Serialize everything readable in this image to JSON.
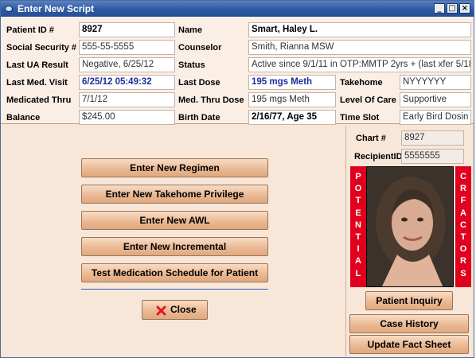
{
  "window": {
    "title": "Enter New Script"
  },
  "window_buttons": {
    "minimize": "_",
    "maximize": "□",
    "close": "×"
  },
  "fields": {
    "patient_id": {
      "label": "Patient ID #",
      "value": "8927"
    },
    "name": {
      "label": "Name",
      "value": "Smart, Haley L."
    },
    "ssn": {
      "label": "Social Security #",
      "value": "555-55-5555"
    },
    "counselor": {
      "label": "Counselor",
      "value": "Smith, Rianna  MSW"
    },
    "last_ua": {
      "label": "Last UA Result",
      "value": "Negative, 6/25/12"
    },
    "status": {
      "label": "Status",
      "value": "Active since 9/1/11 in OTP:MMTP 2yrs + (last xfer 5/18"
    },
    "last_med_visit": {
      "label": "Last Med. Visit",
      "value": "6/25/12 05:49:32"
    },
    "last_dose": {
      "label": "Last Dose",
      "value": "195 mgs Meth"
    },
    "takehome": {
      "label": "Takehome",
      "value": "NYYYYYY"
    },
    "medicated_thru": {
      "label": "Medicated Thru",
      "value": "7/1/12"
    },
    "med_thru_dose": {
      "label": "Med. Thru Dose",
      "value": "195 mgs Meth"
    },
    "level_of_care": {
      "label": "Level Of Care",
      "value": "Supportive"
    },
    "balance": {
      "label": "Balance",
      "value": "$245.00"
    },
    "birth_date": {
      "label": "Birth Date",
      "value": "2/16/77, Age 35"
    },
    "time_slot": {
      "label": "Time Slot",
      "value": "Early Bird Dosin"
    }
  },
  "actions": {
    "new_regimen": "Enter New Regimen",
    "new_takehome": "Enter New Takehome Privilege",
    "new_awl": "Enter New AWL",
    "new_incremental": "Enter New Incremental",
    "test_schedule": "Test Medication Schedule for Patient",
    "close": "Close"
  },
  "side": {
    "chart_label": "Chart #",
    "chart_value": "8927",
    "recipient_label": "RecipientID",
    "recipient_value": "5555555",
    "banner_left": [
      "P",
      "O",
      "T",
      "E",
      "N",
      "T",
      "I",
      "A",
      "L"
    ],
    "banner_right": [
      "C",
      "R",
      "F",
      "A",
      "C",
      "T",
      "O",
      "R",
      "S"
    ],
    "patient_inquiry": "Patient Inquiry",
    "case_history": "Case History",
    "update_fact_sheet": "Update Fact Sheet"
  },
  "colors": {
    "banner": "#e0001e",
    "close_icon": "#e8141e",
    "titlebar": "#2e5aa5",
    "highlight_text": "#1c2f9a"
  },
  "icons": {
    "close_button_icon": "red-x-icon",
    "title_icon": "window-app-icon"
  }
}
